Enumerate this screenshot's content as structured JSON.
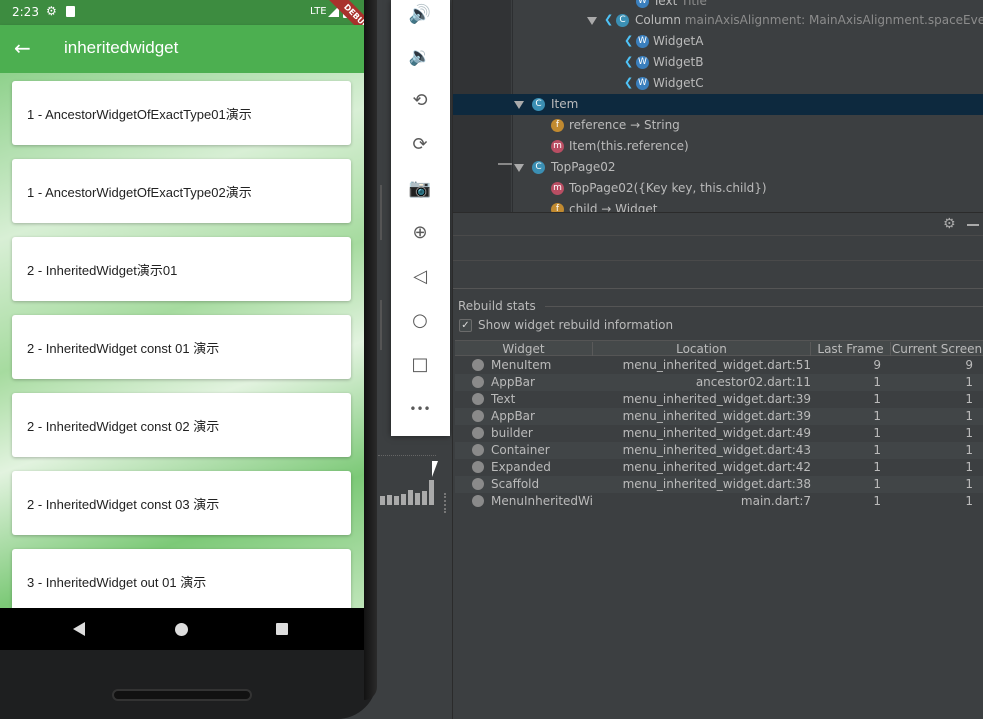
{
  "status_bar": {
    "time": "2:23",
    "network": "LTE",
    "debug_banner": "DEBUG"
  },
  "app_bar": {
    "title": "inheritedwidget"
  },
  "menu_items": [
    {
      "label": "1 - AncestorWidgetOfExactType01演示"
    },
    {
      "label": "1 - AncestorWidgetOfExactType02演示"
    },
    {
      "label": "2 - InheritedWidget演示01"
    },
    {
      "label": "2 - InheritedWidget const 01 演示"
    },
    {
      "label": "2 - InheritedWidget const 02 演示"
    },
    {
      "label": "2 - InheritedWidget const 03 演示"
    },
    {
      "label": "3 - InheritedWidget out 01 演示"
    }
  ],
  "emulator_toolbar": {
    "buttons": [
      {
        "icon": "volume-up-icon",
        "glyph": "🔊"
      },
      {
        "icon": "volume-down-icon",
        "glyph": "🔉"
      },
      {
        "icon": "rotate-left-icon",
        "glyph": "⟲"
      },
      {
        "icon": "rotate-right-icon",
        "glyph": "⟳"
      },
      {
        "icon": "camera-icon",
        "glyph": "📷"
      },
      {
        "icon": "zoom-icon",
        "glyph": "⊕"
      },
      {
        "icon": "back-icon",
        "glyph": "◁"
      },
      {
        "icon": "home-icon",
        "glyph": "○"
      },
      {
        "icon": "overview-icon",
        "glyph": "□"
      },
      {
        "icon": "more-icon",
        "glyph": "•••"
      }
    ]
  },
  "widget_tree": {
    "rows": [
      {
        "label": "Text",
        "sub": "Title",
        "icon": "W"
      },
      {
        "label": "Column",
        "sub": "mainAxisAlignment: MainAxisAlignment.spaceEvenly",
        "icon": "C"
      },
      {
        "label": "WidgetA",
        "sub": "",
        "icon": "W"
      },
      {
        "label": "WidgetB",
        "sub": "",
        "icon": "W"
      },
      {
        "label": "WidgetC",
        "sub": "",
        "icon": "W"
      },
      {
        "label": "Item",
        "sub": "",
        "icon": "C"
      },
      {
        "label": "reference → String",
        "sub": "",
        "icon": "f"
      },
      {
        "label": "Item(this.reference)",
        "sub": "",
        "icon": "m"
      },
      {
        "label": "TopPage02",
        "sub": "",
        "icon": "C"
      },
      {
        "label": "TopPage02({Key key, this.child})",
        "sub": "",
        "icon": "m"
      },
      {
        "label": "child → Widget",
        "sub": "",
        "icon": "f"
      }
    ]
  },
  "rebuild_stats": {
    "title": "Rebuild stats",
    "checkbox_label": "Show widget rebuild information",
    "checkbox_checked": true,
    "columns": [
      "Widget",
      "Location",
      "Last Frame",
      "Current Screen"
    ],
    "rows": [
      {
        "widget": "MenuItem",
        "location": "menu_inherited_widget.dart:51",
        "last": "9",
        "current": "9"
      },
      {
        "widget": "AppBar",
        "location": "ancestor02.dart:11",
        "last": "1",
        "current": "1"
      },
      {
        "widget": "Text",
        "location": "menu_inherited_widget.dart:39",
        "last": "1",
        "current": "1"
      },
      {
        "widget": "AppBar",
        "location": "menu_inherited_widget.dart:39",
        "last": "1",
        "current": "1"
      },
      {
        "widget": "builder",
        "location": "menu_inherited_widget.dart:49",
        "last": "1",
        "current": "1"
      },
      {
        "widget": "Container",
        "location": "menu_inherited_widget.dart:43",
        "last": "1",
        "current": "1"
      },
      {
        "widget": "Expanded",
        "location": "menu_inherited_widget.dart:42",
        "last": "1",
        "current": "1"
      },
      {
        "widget": "Scaffold",
        "location": "menu_inherited_widget.dart:38",
        "last": "1",
        "current": "1"
      },
      {
        "widget": "MenuInheritedWidget",
        "location": "main.dart:7",
        "last": "1",
        "current": "1"
      }
    ]
  },
  "colors": {
    "app_bar": "#4caf50",
    "status_bar": "#3d8c40",
    "ide_background": "#3c3f41",
    "tree_selected": "#0d293e"
  }
}
